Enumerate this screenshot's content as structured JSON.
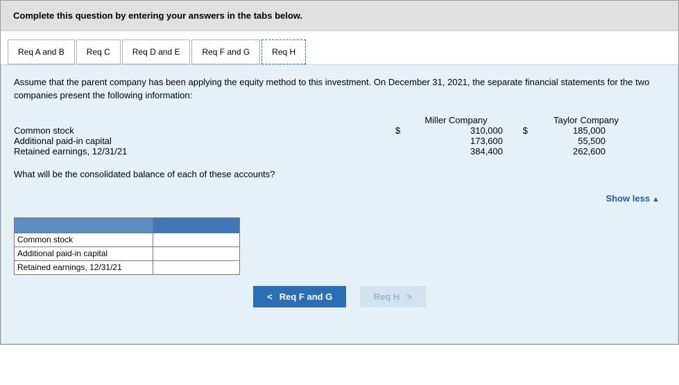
{
  "instruction": "Complete this question by entering your answers in the tabs below.",
  "tabs": {
    "t0": "Req A and B",
    "t1": "Req C",
    "t2": "Req D and E",
    "t3": "Req F and G",
    "t4": "Req H"
  },
  "paragraph": "Assume that the parent company has been applying the equity method to this investment. On December 31, 2021, the separate financial statements for the two companies present the following information:",
  "table": {
    "headers": {
      "c1": "Miller Company",
      "c2": "Taylor Company"
    },
    "rows": {
      "r0": {
        "label": "Common stock",
        "sym1": "$",
        "v1": "310,000",
        "sym2": "$",
        "v2": "185,000"
      },
      "r1": {
        "label": "Additional paid-in capital",
        "sym1": "",
        "v1": "173,600",
        "sym2": "",
        "v2": "55,500"
      },
      "r2": {
        "label": "Retained earnings, 12/31/21",
        "sym1": "",
        "v1": "384,400",
        "sym2": "",
        "v2": "262,600"
      }
    }
  },
  "question": "What will be the consolidated balance of each of these accounts?",
  "show_less": "Show less",
  "answer_rows": {
    "a0": "Common stock",
    "a1": "Additional paid-in capital",
    "a2": "Retained earnings, 12/31/21"
  },
  "nav": {
    "prev": "Req F and G",
    "next": "Req H"
  }
}
